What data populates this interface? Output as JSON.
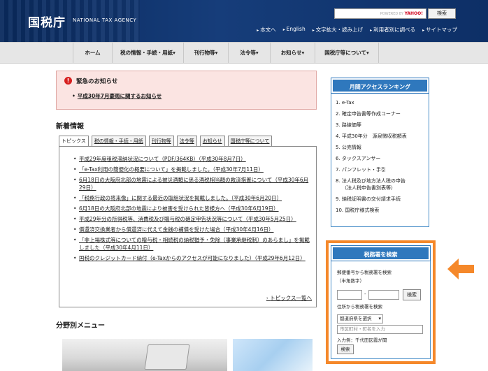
{
  "header": {
    "logo": "国税庁",
    "logo_sub": "NATIONAL TAX AGENCY",
    "search_powered": "POWERED BY",
    "search_powered_brand": "YAHOO!",
    "search_button": "検索",
    "utility_links": [
      "本文へ",
      "English",
      "文字拡大・読み上げ",
      "利用者別に調べる",
      "サイトマップ"
    ]
  },
  "gnav": [
    {
      "label": "ホーム"
    },
    {
      "label": "税の情報・手続・用紙▾"
    },
    {
      "label": "刊行物等▾"
    },
    {
      "label": "法令等▾"
    },
    {
      "label": "お知らせ▾"
    },
    {
      "label": "国税庁等について▾"
    }
  ],
  "emergency": {
    "title": "緊急のお知らせ",
    "link": "平成30年7月豪雨に関するお知らせ"
  },
  "news": {
    "title": "新着情報",
    "tabs": [
      "トピックス",
      "税の情報・手続・用紙",
      "刊行物等",
      "法令等",
      "お知らせ",
      "国税庁等について"
    ],
    "items": [
      "平成29年度租税滞納状況について（PDF/364KB）（平成30年8月7日）",
      "「e-Tax利用の簡便化の概要について」を掲載しました。（平成30年7月11日）",
      "6月18日の大阪府北部の地震による被災酒類に係る酒税相当額の救済措置について（平成30年6月29日）",
      "「税務行政の将来像」に関する最近の取組状況を掲載しました。（平成30年6月20日）",
      "6月18日の大阪府北部の地震により被害を受けられた皆様方へ（平成30年6月19日）",
      "平成29年分の所得税等、消費税及び贈与税の確定申告状況等について（平成30年5月25日）",
      "償還済交換業者から償還済に代えて金銭の補償を受けた場合（平成30年4月16日）",
      "「非上場株式等についての贈与税・相続税の納税猶予・免除（事業承継税制）のあらまし」を掲載しました（平成30年4月11日）",
      "国税のクレジットカード納付（e-Taxからのアクセスが可能になりました）（平成29年6月12日）"
    ],
    "more": "トピックス一覧へ"
  },
  "field_menu": {
    "title": "分野別メニュー"
  },
  "ranking": {
    "title": "月間アクセスランキング",
    "items": [
      [
        "1. e-Tax"
      ],
      [
        "2. 確定申告書等作成コーナー"
      ],
      [
        "3. 路線価等"
      ],
      [
        "4. 平成30年分　源泉徴収税額表"
      ],
      [
        "5. 公売情報"
      ],
      [
        "6. タックスアンサー"
      ],
      [
        "7. パンフレット・手引"
      ],
      [
        "8. 法人税及び地方法人税の申告",
        "（法人税申告書別表等）"
      ],
      [
        "9. 納税証明書の交付請求手続"
      ],
      [
        "10. 国税庁様式検索"
      ]
    ]
  },
  "office": {
    "title": "税務署を検索",
    "zip_label": "郵便番号から税務署を検索",
    "zip_note": "（半角数字）",
    "zip_dash": "-",
    "zip_button": "検索",
    "address_label": "住所から税務署を検索",
    "pref_select": "都道府県を選択",
    "city_placeholder": "市区町村・町名を入力",
    "example": "入力例：千代田区霞が関",
    "button": "検索"
  },
  "colors": {
    "accent_orange": "#f5882a",
    "panel_blue": "#2f78bd",
    "header_navy": "#0a2a5e"
  }
}
